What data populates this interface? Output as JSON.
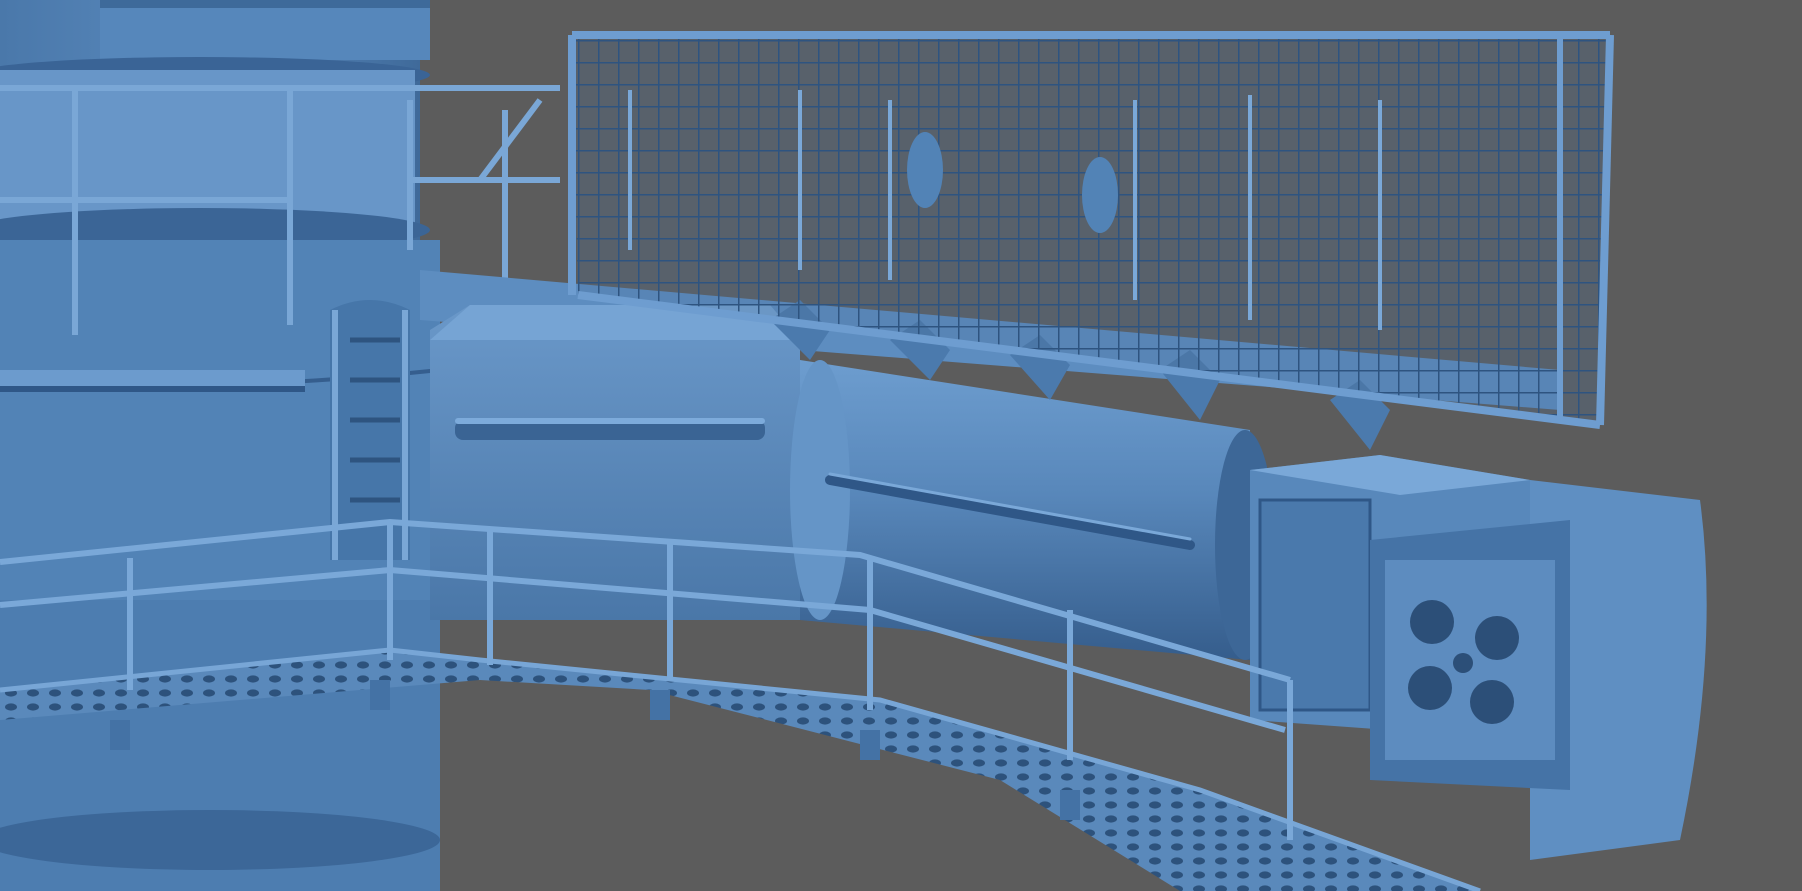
{
  "scene": {
    "subject": "ship-mast-radar-platform",
    "colors": {
      "background": "#5c5c5c",
      "model_light": "#6f9fd0",
      "model_mid": "#4f7fb2",
      "model_dark": "#2f5582",
      "model_shadow": "#1f3c5e"
    }
  }
}
